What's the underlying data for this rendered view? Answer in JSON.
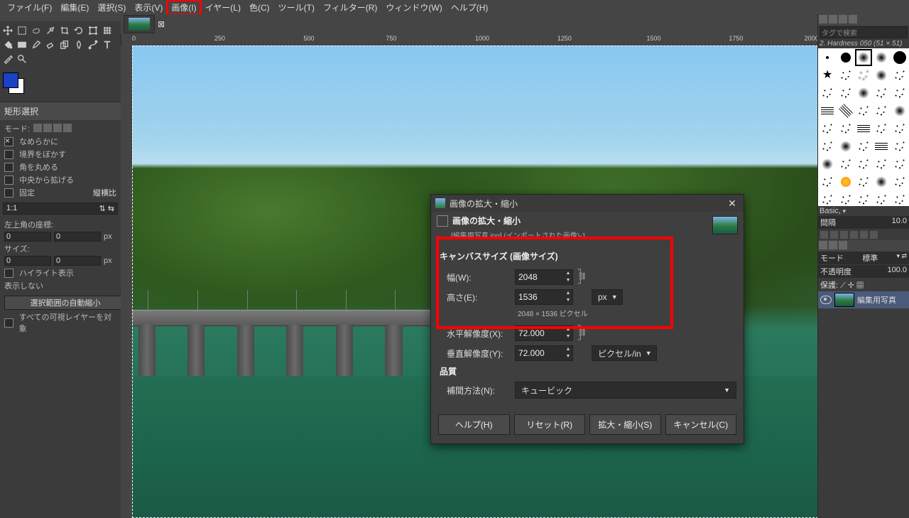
{
  "menu": {
    "items": [
      "ファイル(F)",
      "編集(E)",
      "選択(S)",
      "表示(V)",
      "画像(I)",
      "イヤー(L)",
      "色(C)",
      "ツール(T)",
      "フィルター(R)",
      "ウィンドウ(W)",
      "ヘルプ(H)"
    ],
    "highlight_index": 4
  },
  "toolbox": {
    "options_title": "矩形選択",
    "mode_label": "モード:",
    "smooth": "なめらかに",
    "feather": "境界をぼかす",
    "round": "角を丸める",
    "expand": "中央から拡げる",
    "fixed_label": "固定",
    "fixed_value": "縦横比",
    "ratio": "1:1",
    "pos_label": "左上角の座標:",
    "pos_x": "0",
    "pos_y": "0",
    "size_label": "サイズ:",
    "size_w": "0",
    "size_h": "0",
    "highlight": "ハイライト表示",
    "noshow": "表示しない",
    "auto_shrink": "選択範囲の自動縮小",
    "all_layers": "すべての可視レイヤーを対象",
    "pos_unit": "px"
  },
  "ruler": {
    "ticks": [
      "0",
      "250",
      "500",
      "750",
      "1000",
      "1250",
      "1500",
      "1750",
      "2000"
    ]
  },
  "right": {
    "search_placeholder": "タグで検索",
    "brush_title": "2. Hardness 050 (51 × 51)",
    "basic": "Basic,",
    "spacing_label": "間隔",
    "spacing_value": "10.0",
    "mode_label": "モード",
    "mode_value": "標準",
    "opacity_label": "不透明度",
    "opacity_value": "100.0",
    "protect_label": "保護:",
    "layer_name": "編集用写真"
  },
  "dialog": {
    "title": "画像の拡大・縮小",
    "subtitle": "画像の拡大・縮小",
    "filename_line": "[編集用写真.jpg] (インポートされた画像)-1",
    "canvas_section": "キャンバスサイズ (画像サイズ)",
    "width_label": "幅(W):",
    "width_value": "2048",
    "height_label": "高さ(E):",
    "height_value": "1536",
    "unit_px": "px",
    "dim_caption": "2048 × 1536 ピクセル",
    "hres_label": "水平解像度(X):",
    "hres_value": "72.000",
    "vres_label": "垂直解像度(Y):",
    "vres_value": "72.000",
    "res_unit": "ピクセル/in",
    "quality_section": "品質",
    "interp_label": "補間方法(N):",
    "interp_value": "キュービック",
    "btn_help": "ヘルプ(H)",
    "btn_reset": "リセット(R)",
    "btn_scale": "拡大・縮小(S)",
    "btn_cancel": "キャンセル(C)"
  }
}
